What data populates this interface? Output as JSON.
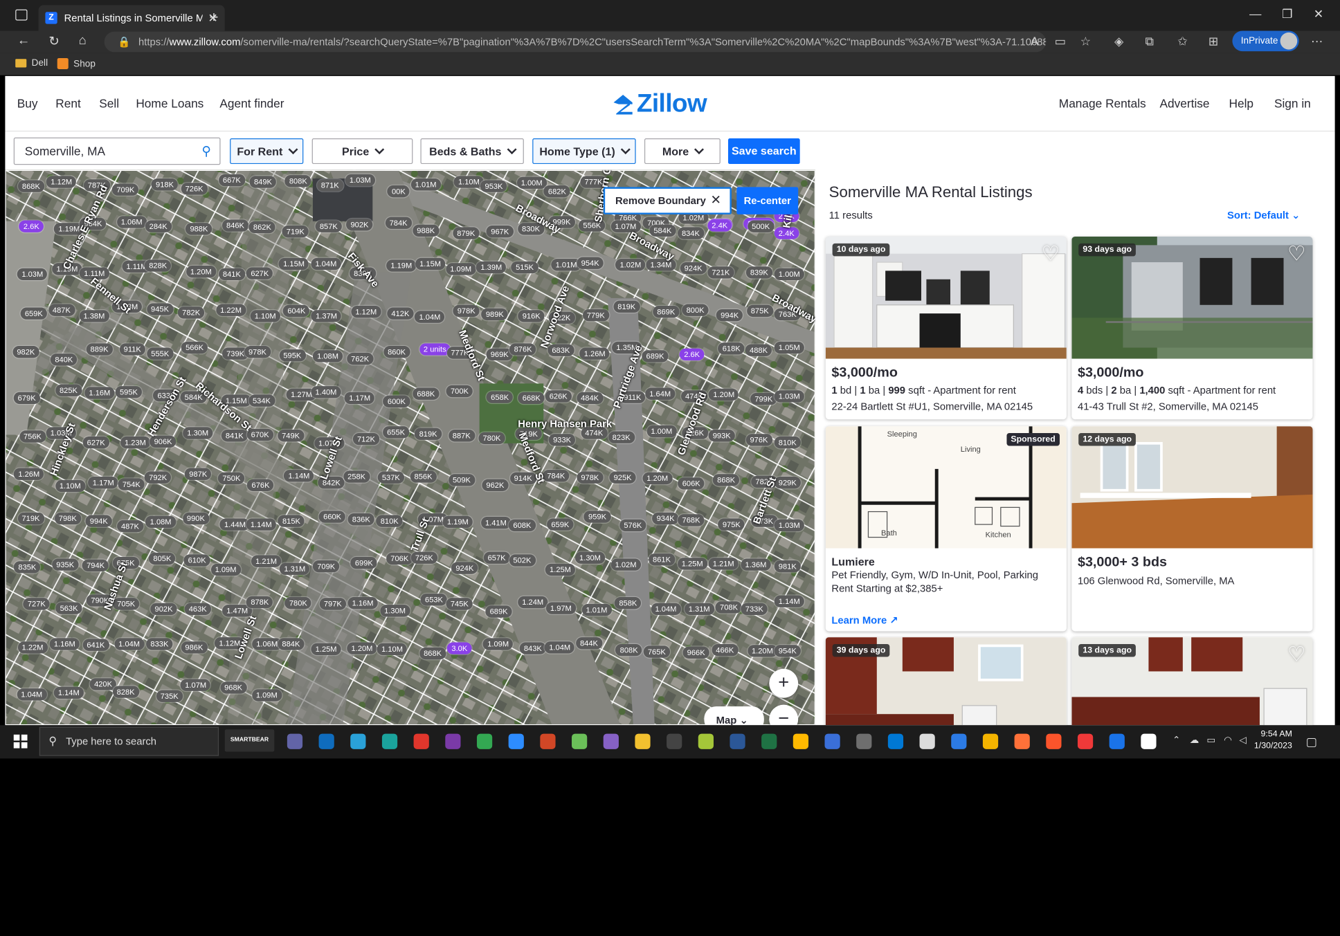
{
  "browser": {
    "tab_title": "Rental Listings in Somerville MA",
    "url_prefix": "https://",
    "url_domain": "www.zillow.com",
    "url_rest": "/somerville-ma/rentals/?searchQueryState=%7B\"pagination\"%3A%7B%7D%2C\"usersSearchTerm\"%3A\"Somerville%2C%20MA\"%2C\"mapBounds\"%3A%7B\"west\"%3A-71.10688618454...",
    "inprivate_label": "InPrivate",
    "bookmarks": [
      "Dell",
      "Shop"
    ]
  },
  "header": {
    "nav_left": [
      "Buy",
      "Rent",
      "Sell",
      "Home Loans",
      "Agent finder"
    ],
    "logo_text": "Zillow",
    "nav_right": [
      "Manage Rentals",
      "Advertise",
      "Help",
      "Sign in"
    ],
    "brand_color": "#1277e1"
  },
  "filters": {
    "search_value": "Somerville, MA",
    "for_rent": "For Rent",
    "price": "Price",
    "beds_baths": "Beds & Baths",
    "home_type": "Home Type (1)",
    "more": "More",
    "save_search": "Save search"
  },
  "map": {
    "remove_boundary": "Remove Boundary",
    "recenter": "Re-center",
    "zoom_in": "+",
    "zoom_out": "−",
    "map_type": "Map",
    "streets": [
      "Broadway",
      "Broadway",
      "Broadway",
      "Medford St",
      "Medford St",
      "Lowell St",
      "Lowell St",
      "Richardson St",
      "Henderson St",
      "Hinckley St",
      "Fisk Ave",
      "Norwood Ave",
      "Partridge Ave",
      "Glenwood Rd",
      "Bartlett St",
      "Trull St",
      "Henry Hansen Park",
      "Nashua St",
      "Fennell St",
      "Charles E Ryan Rd",
      "Sherborn Ct",
      "Kils"
    ],
    "price_pins": [
      "868K",
      "1.12M",
      "787K",
      "709K",
      "918K",
      "726K",
      "667K",
      "849K",
      "808K",
      "871K",
      "1.03M",
      "00K",
      "1.01M",
      "1.10M",
      "953K",
      "1.00M",
      "682K",
      "777K",
      "766K",
      "700K",
      "1.02M",
      "2.5K",
      "2 units",
      "2.5K",
      "2.6K",
      "1.19M",
      "964K",
      "1.06M",
      "284K",
      "988K",
      "846K",
      "862K",
      "719K",
      "857K",
      "902K",
      "784K",
      "988K",
      "879K",
      "967K",
      "830K",
      "999K",
      "556K",
      "1.07M",
      "584K",
      "834K",
      "2.4K",
      "500K",
      "2.4K",
      "1.03M",
      "1.19M",
      "1.11M",
      "1.11M",
      "828K",
      "1.20M",
      "841K",
      "627K",
      "1.15M",
      "1.04M",
      "839K",
      "1.19M",
      "1.15M",
      "1.09M",
      "1.39M",
      "515K",
      "1.01M",
      "954K",
      "1.02M",
      "1.34M",
      "924K",
      "721K",
      "839K",
      "1.00M",
      "659K",
      "487K",
      "1.38M",
      "1.03M",
      "945K",
      "782K",
      "1.22M",
      "1.10M",
      "604K",
      "1.37M",
      "1.12M",
      "412K",
      "1.04M",
      "978K",
      "989K",
      "916K",
      "822K",
      "779K",
      "819K",
      "869K",
      "800K",
      "994K",
      "875K",
      "763K",
      "982K",
      "840K",
      "889K",
      "911K",
      "555K",
      "566K",
      "739K",
      "978K",
      "595K",
      "1.08M",
      "762K",
      "860K",
      "2 units",
      "777K",
      "969K",
      "876K",
      "683K",
      "1.26M",
      "1.35M",
      "689K",
      "2.6K",
      "618K",
      "488K",
      "1.05M",
      "679K",
      "825K",
      "1.16M",
      "595K",
      "633K",
      "584K",
      "1.15M",
      "534K",
      "1.27M",
      "1.40M",
      "1.17M",
      "600K",
      "688K",
      "700K",
      "658K",
      "668K",
      "626K",
      "484K",
      "911K",
      "1.64M",
      "474K",
      "1.20M",
      "799K",
      "1.03M",
      "756K",
      "1.03M",
      "627K",
      "1.23M",
      "906K",
      "1.30M",
      "841K",
      "670K",
      "749K",
      "1.07M",
      "712K",
      "655K",
      "819K",
      "887K",
      "780K",
      "719K",
      "933K",
      "474K",
      "823K",
      "1.00M",
      "926K",
      "993K",
      "976K",
      "810K",
      "1.26M",
      "1.10M",
      "1.17M",
      "754K",
      "792K",
      "987K",
      "750K",
      "676K",
      "1.14M",
      "842K",
      "258K",
      "537K",
      "856K",
      "509K",
      "962K",
      "914K",
      "784K",
      "978K",
      "925K",
      "1.20M",
      "606K",
      "868K",
      "782K",
      "929K",
      "719K",
      "798K",
      "994K",
      "487K",
      "1.08M",
      "990K",
      "1.44M",
      "1.14M",
      "815K",
      "660K",
      "836K",
      "810K",
      "1.07M",
      "1.19M",
      "1.41M",
      "608K",
      "659K",
      "959K",
      "576K",
      "934K",
      "768K",
      "975K",
      "873K",
      "1.03M",
      "835K",
      "935K",
      "794K",
      "675K",
      "805K",
      "610K",
      "1.09M",
      "1.21M",
      "1.31M",
      "709K",
      "699K",
      "706K",
      "726K",
      "924K",
      "657K",
      "502K",
      "1.25M",
      "1.30M",
      "1.02M",
      "861K",
      "1.25M",
      "1.21M",
      "1.36M",
      "981K",
      "727K",
      "563K",
      "790K",
      "705K",
      "902K",
      "463K",
      "1.47M",
      "878K",
      "780K",
      "797K",
      "1.16M",
      "1.30M",
      "653K",
      "745K",
      "689K",
      "1.24M",
      "1.97M",
      "1.01M",
      "858K",
      "1.04M",
      "1.31M",
      "708K",
      "733K",
      "1.14M",
      "1.22M",
      "1.16M",
      "641K",
      "1.04M",
      "833K",
      "986K",
      "1.12M",
      "1.06M",
      "884K",
      "1.25M",
      "1.20M",
      "1.10M",
      "868K",
      "3.0K",
      "1.09M",
      "843K",
      "1.04M",
      "844K",
      "808K",
      "765K",
      "966K",
      "466K",
      "1.20M",
      "954K",
      "1.04M",
      "1.14M",
      "420K",
      "828K",
      "735K",
      "1.07M",
      "968K",
      "1.09M"
    ]
  },
  "listings": {
    "title": "Somerville MA Rental Listings",
    "results": "11 results",
    "sort": "Sort: Default",
    "cards": [
      {
        "badge": "10 days ago",
        "price": "$3,000/mo",
        "beds": "1",
        "beds_unit": "bd",
        "baths": "1",
        "baths_unit": "ba",
        "sqft": "999",
        "sqft_unit": "sqft",
        "type": "- Apartment for rent",
        "address": "22-24 Bartlett St #U1, Somerville, MA 02145"
      },
      {
        "badge": "93 days ago",
        "price": "$3,000/mo",
        "beds": "4",
        "beds_unit": "bds",
        "baths": "2",
        "baths_unit": "ba",
        "sqft": "1,400",
        "sqft_unit": "sqft",
        "type": "- Apartment for rent",
        "address": "41-43 Trull St #2, Somerville, MA 02145"
      },
      {
        "badge": "Sponsored",
        "name": "Lumiere",
        "desc": "Pet Friendly, Gym, W/D In-Unit, Pool, Parking",
        "rent": "Rent Starting at $2,385+",
        "learn": "Learn More",
        "plan_labels": [
          "Sleeping",
          "Living",
          "Bath",
          "Kitchen"
        ]
      },
      {
        "badge": "12 days ago",
        "price": "$3,000+ 3 bds",
        "address": "106 Glenwood Rd, Somerville, MA"
      },
      {
        "badge": "39 days ago"
      },
      {
        "badge": "13 days ago"
      }
    ]
  },
  "taskbar": {
    "search_placeholder": "Type here to search",
    "smartbear": "SMARTBEAR",
    "time": "9:54 AM",
    "date": "1/30/2023"
  }
}
